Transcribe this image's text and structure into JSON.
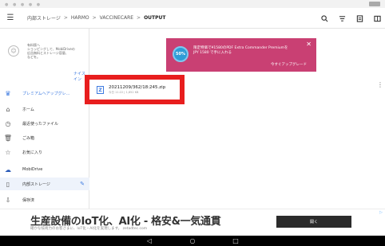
{
  "toolbar": {
    "breadcrumbs": [
      "内部ストレージ",
      "HARMO",
      "VACCINECARE",
      "OUTPUT"
    ],
    "separator": ">"
  },
  "sidebar": {
    "promo_text": "有料版へ\nショッピングして、MobiDriveの\n広告無料とストレージ容量、\nなどを。",
    "promo_link": "ナイスイン",
    "items": [
      {
        "label": "プレミアムへアップグレ...",
        "icon": "crown-icon"
      },
      {
        "label": "ホーム",
        "icon": "home-icon"
      },
      {
        "label": "最近使ったファイル",
        "icon": "clock-icon"
      },
      {
        "label": "ごみ箱",
        "icon": "trash-icon"
      },
      {
        "label": "お気に入り",
        "icon": "star-icon"
      },
      {
        "label": "MobiDrive",
        "icon": "cloud-icon"
      },
      {
        "label": "内部ストレージ",
        "icon": "phone-icon"
      },
      {
        "label": "保存済",
        "icon": "download-icon"
      }
    ]
  },
  "file": {
    "name": "20211209/362/18:245.zip",
    "meta": "今日 11:22 | 1,852 KB"
  },
  "banner": {
    "badge": "50%",
    "text": "限定特価で¥1580のPDF Extra Commander Premiumを JPY 1580 で手に入れる",
    "link": "今すぐアップグレード"
  },
  "ad": {
    "title": "生産設備のIoT化、AI化 - 格安&一気通貫",
    "subtitle": "確かな技術力のお客さまに、IoT化・AI化を実現します。 zetadtec.com",
    "button": "開く",
    "marker": "▷"
  },
  "colors": {
    "accent": "#3d7ae0",
    "banner": "#c94073",
    "highlight": "#e81e1e"
  }
}
